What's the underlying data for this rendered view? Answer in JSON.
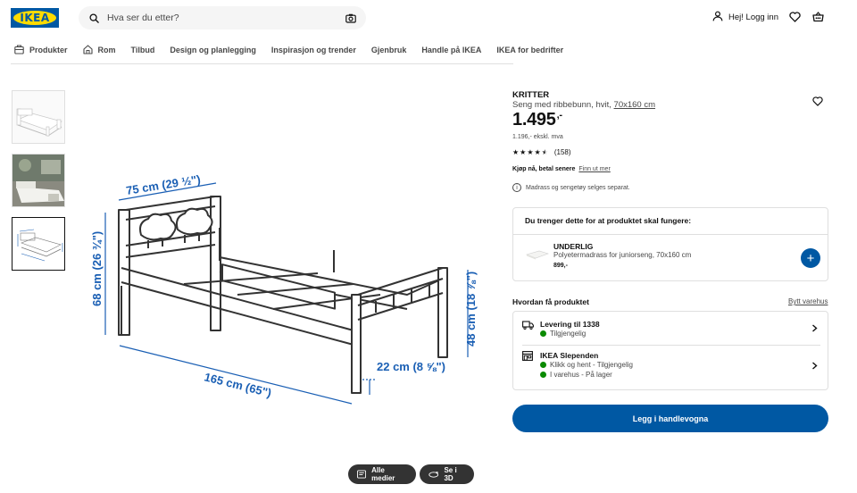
{
  "header": {
    "logo_text": "IKEA",
    "search_placeholder": "Hva ser du etter?",
    "login_label": "Hej! Logg inn"
  },
  "nav": {
    "items": [
      {
        "label": "Produkter",
        "icon": "products-icon"
      },
      {
        "label": "Rom",
        "icon": "home-icon"
      },
      {
        "label": "Tilbud"
      },
      {
        "label": "Design og planlegging"
      },
      {
        "label": "Inspirasjon og trender"
      },
      {
        "label": "Gjenbruk"
      },
      {
        "label": "Handle på IKEA"
      },
      {
        "label": "IKEA for bedrifter"
      }
    ]
  },
  "gallery": {
    "dimensions": {
      "width": "75 cm (29 ½\")",
      "height": "68 cm (26 ¾\")",
      "length": "165 cm (65\")",
      "foot_height": "48 cm (18 ⅞\")",
      "under_height": "22 cm (8 ⅝\")"
    },
    "all_media_label": "Alle medier",
    "view_3d_label": "Se i 3D"
  },
  "product": {
    "name": "KRITTER",
    "desc_prefix": "Seng med ribbebunn, hvit, ",
    "desc_size": "70x160 cm",
    "price": "1.495",
    "price_suffix": ",-",
    "excl_vat": "1.196,- ekskl. mva",
    "rating": 4.5,
    "rating_count": "(158)",
    "kjop_bold": "Kjøp nå, betal senere",
    "kjop_link": "Finn ut mer",
    "note": "Madrass og sengetøy selges separat."
  },
  "need": {
    "heading": "Du trenger dette for at produktet skal fungere:",
    "item_name": "UNDERLIG",
    "item_desc": "Polyetermadrass for juniorseng, 70x160 cm",
    "item_price": "899,-"
  },
  "availability": {
    "heading": "Hvordan få produktet",
    "change_store": "Bytt varehus",
    "delivery_title": "Levering til 1338",
    "delivery_status": "Tilgjengelig",
    "store_title": "IKEA Slependen",
    "store_line1": "Klikk og hent - Tilgjengelig",
    "store_line2": "I varehus - På lager",
    "status_color": "#0a8a00"
  },
  "cta": {
    "add_to_cart": "Legg i handlevogna"
  },
  "colors": {
    "brand_blue": "#0058a3",
    "brand_yellow": "#ffdb00",
    "dimension_blue": "#1a5fb4"
  }
}
